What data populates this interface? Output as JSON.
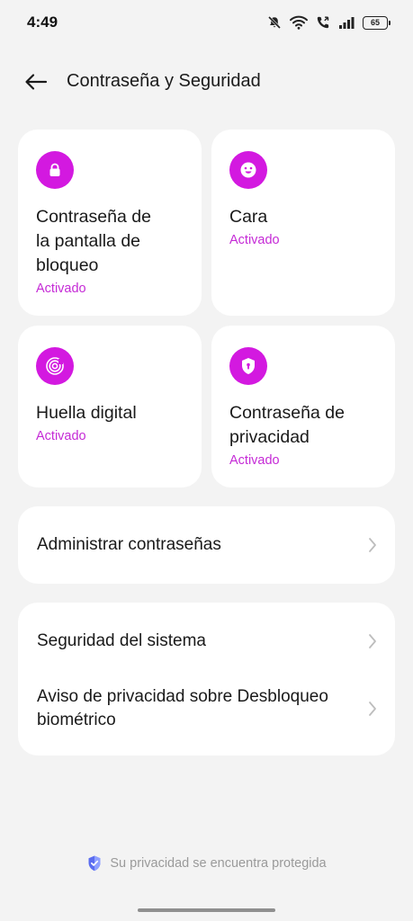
{
  "status_bar": {
    "time": "4:49",
    "battery": "65",
    "icons": [
      "mute-icon",
      "wifi-icon",
      "call-icon",
      "signal-icon",
      "battery-icon"
    ]
  },
  "header": {
    "title": "Contraseña y Seguridad",
    "back_icon": "back-arrow-icon"
  },
  "tiles": [
    {
      "title": "Contraseña de\nla pantalla de\nbloqueo",
      "status": "Activado",
      "icon": "lock-icon"
    },
    {
      "title": "Cara",
      "status": "Activado",
      "icon": "face-icon"
    },
    {
      "title": "Huella digital",
      "status": "Activado",
      "icon": "fingerprint-icon"
    },
    {
      "title": "Contraseña de\nprivacidad",
      "status": "Activado",
      "icon": "privacy-shield-icon"
    }
  ],
  "list_group_1": [
    {
      "label": "Administrar contraseñas"
    }
  ],
  "list_group_2": [
    {
      "label": "Seguridad del sistema"
    },
    {
      "label": "Aviso de privacidad sobre Desbloqueo biométrico"
    }
  ],
  "footer": {
    "text": "Su privacidad se encuentra protegida",
    "icon": "shield-check-icon"
  },
  "colors": {
    "accent": "#d319e0",
    "status_text": "#c52ad6",
    "background": "#f3f3f3"
  }
}
